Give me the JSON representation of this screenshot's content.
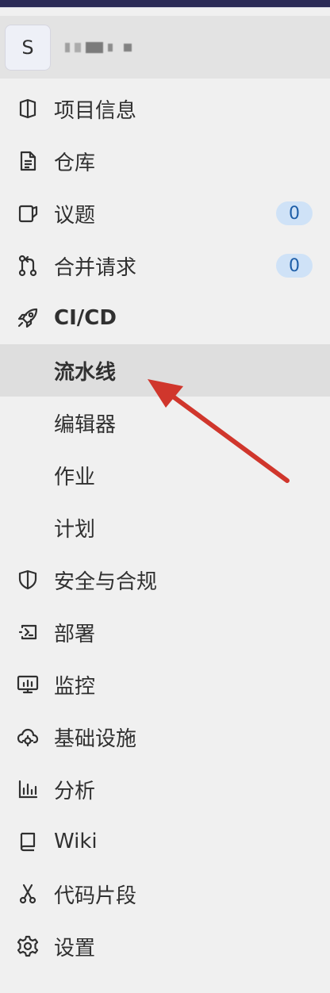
{
  "project": {
    "avatar_letter": "S"
  },
  "nav": {
    "items": [
      {
        "label": "项目信息",
        "icon": "project-info-icon"
      },
      {
        "label": "仓库",
        "icon": "document-icon"
      },
      {
        "label": "议题",
        "icon": "issues-icon",
        "badge": "0"
      },
      {
        "label": "合并请求",
        "icon": "merge-request-icon",
        "badge": "0"
      },
      {
        "label": "CI/CD",
        "icon": "rocket-icon"
      },
      {
        "label": "流水线"
      },
      {
        "label": "编辑器"
      },
      {
        "label": "作业"
      },
      {
        "label": "计划"
      },
      {
        "label": "安全与合规",
        "icon": "shield-icon"
      },
      {
        "label": "部署",
        "icon": "deploy-icon"
      },
      {
        "label": "监控",
        "icon": "monitor-icon"
      },
      {
        "label": "基础设施",
        "icon": "cloud-gear-icon"
      },
      {
        "label": "分析",
        "icon": "chart-icon"
      },
      {
        "label": "Wiki",
        "icon": "book-icon"
      },
      {
        "label": "代码片段",
        "icon": "scissors-icon"
      },
      {
        "label": "设置",
        "icon": "gear-icon"
      }
    ]
  },
  "colors": {
    "topbar": "#2b2a56",
    "sidebar_bg": "#f0f0f0",
    "active_bg": "#dedede",
    "badge_bg": "#cfe2f7",
    "badge_text": "#1f5fa8",
    "annotation_arrow": "#d0362c"
  }
}
